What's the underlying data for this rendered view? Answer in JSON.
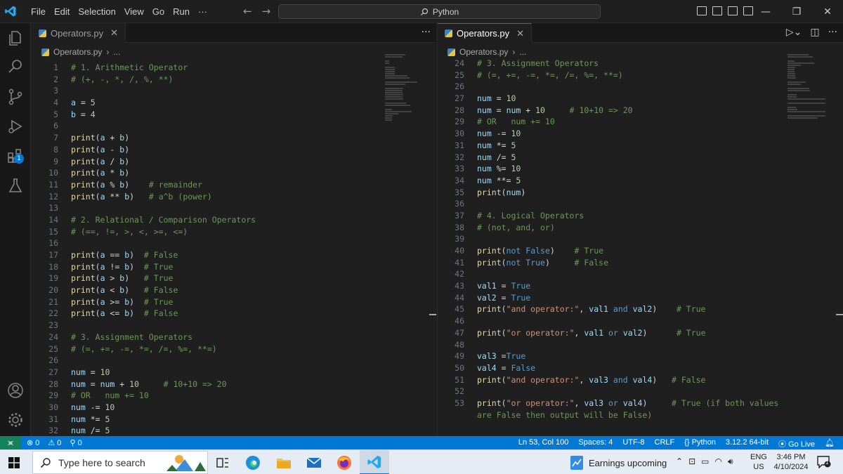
{
  "titlebar": {
    "menu": [
      "File",
      "Edit",
      "Selection",
      "View",
      "Go",
      "Run",
      "···"
    ],
    "search_text": "Python",
    "colors": {
      "accent": "#0078d4",
      "vscode_blue": "#23a9f2"
    }
  },
  "editor_left": {
    "tab_label": "Operators.py",
    "breadcrumb_file": "Operators.py",
    "breadcrumb_more": "...",
    "more_actions": "···",
    "lines": [
      {
        "n": "1",
        "segs": [
          [
            "# 1. Arithmetic Operator",
            "cm"
          ]
        ]
      },
      {
        "n": "2",
        "segs": [
          [
            "# (+, -, *, /, %, **)",
            "cm"
          ]
        ]
      },
      {
        "n": "3",
        "segs": []
      },
      {
        "n": "4",
        "segs": [
          [
            "a",
            "var"
          ],
          [
            " = ",
            "pl"
          ],
          [
            "5",
            "num"
          ]
        ]
      },
      {
        "n": "5",
        "segs": [
          [
            "b",
            "var"
          ],
          [
            " = ",
            "pl"
          ],
          [
            "4",
            "num"
          ]
        ]
      },
      {
        "n": "6",
        "segs": []
      },
      {
        "n": "7",
        "segs": [
          [
            "print",
            "fn"
          ],
          [
            "(",
            "pl"
          ],
          [
            "a",
            "var"
          ],
          [
            " + ",
            "pl"
          ],
          [
            "b",
            "var"
          ],
          [
            ")",
            "pl"
          ]
        ]
      },
      {
        "n": "8",
        "segs": [
          [
            "print",
            "fn"
          ],
          [
            "(",
            "pl"
          ],
          [
            "a",
            "var"
          ],
          [
            " - ",
            "pl"
          ],
          [
            "b",
            "var"
          ],
          [
            ")",
            "pl"
          ]
        ]
      },
      {
        "n": "9",
        "segs": [
          [
            "print",
            "fn"
          ],
          [
            "(",
            "pl"
          ],
          [
            "a",
            "var"
          ],
          [
            " / ",
            "pl"
          ],
          [
            "b",
            "var"
          ],
          [
            ")",
            "pl"
          ]
        ]
      },
      {
        "n": "10",
        "segs": [
          [
            "print",
            "fn"
          ],
          [
            "(",
            "pl"
          ],
          [
            "a",
            "var"
          ],
          [
            " * ",
            "pl"
          ],
          [
            "b",
            "var"
          ],
          [
            ")",
            "pl"
          ]
        ]
      },
      {
        "n": "11",
        "segs": [
          [
            "print",
            "fn"
          ],
          [
            "(",
            "pl"
          ],
          [
            "a",
            "var"
          ],
          [
            " % ",
            "pl"
          ],
          [
            "b",
            "var"
          ],
          [
            ")",
            "pl"
          ],
          [
            "    # remainder",
            "cm"
          ]
        ]
      },
      {
        "n": "12",
        "segs": [
          [
            "print",
            "fn"
          ],
          [
            "(",
            "pl"
          ],
          [
            "a",
            "var"
          ],
          [
            " ** ",
            "pl"
          ],
          [
            "b",
            "var"
          ],
          [
            ")",
            "pl"
          ],
          [
            "   # a^b (power)",
            "cm"
          ]
        ]
      },
      {
        "n": "13",
        "segs": []
      },
      {
        "n": "14",
        "segs": [
          [
            "# 2. Relational / Comparison Operators",
            "cm"
          ]
        ]
      },
      {
        "n": "15",
        "segs": [
          [
            "# (==, !=, >, <, >=, <=)",
            "cm"
          ]
        ]
      },
      {
        "n": "16",
        "segs": []
      },
      {
        "n": "17",
        "segs": [
          [
            "print",
            "fn"
          ],
          [
            "(",
            "pl"
          ],
          [
            "a",
            "var"
          ],
          [
            " == ",
            "pl"
          ],
          [
            "b",
            "var"
          ],
          [
            ")",
            "pl"
          ],
          [
            "  # False",
            "cm"
          ]
        ]
      },
      {
        "n": "18",
        "segs": [
          [
            "print",
            "fn"
          ],
          [
            "(",
            "pl"
          ],
          [
            "a",
            "var"
          ],
          [
            " != ",
            "pl"
          ],
          [
            "b",
            "var"
          ],
          [
            ")",
            "pl"
          ],
          [
            "  # True",
            "cm"
          ]
        ]
      },
      {
        "n": "19",
        "segs": [
          [
            "print",
            "fn"
          ],
          [
            "(",
            "pl"
          ],
          [
            "a",
            "var"
          ],
          [
            " > ",
            "pl"
          ],
          [
            "b",
            "var"
          ],
          [
            ")",
            "pl"
          ],
          [
            "   # True",
            "cm"
          ]
        ]
      },
      {
        "n": "20",
        "segs": [
          [
            "print",
            "fn"
          ],
          [
            "(",
            "pl"
          ],
          [
            "a",
            "var"
          ],
          [
            " < ",
            "pl"
          ],
          [
            "b",
            "var"
          ],
          [
            ")",
            "pl"
          ],
          [
            "   # False",
            "cm"
          ]
        ]
      },
      {
        "n": "21",
        "segs": [
          [
            "print",
            "fn"
          ],
          [
            "(",
            "pl"
          ],
          [
            "a",
            "var"
          ],
          [
            " >= ",
            "pl"
          ],
          [
            "b",
            "var"
          ],
          [
            ")",
            "pl"
          ],
          [
            "  # True",
            "cm"
          ]
        ]
      },
      {
        "n": "22",
        "segs": [
          [
            "print",
            "fn"
          ],
          [
            "(",
            "pl"
          ],
          [
            "a",
            "var"
          ],
          [
            " <= ",
            "pl"
          ],
          [
            "b",
            "var"
          ],
          [
            ")",
            "pl"
          ],
          [
            "  # False",
            "cm"
          ]
        ]
      },
      {
        "n": "23",
        "segs": []
      },
      {
        "n": "24",
        "segs": [
          [
            "# 3. Assignment Operators",
            "cm"
          ]
        ]
      },
      {
        "n": "25",
        "segs": [
          [
            "# (=, +=, -=, *=, /=, %=, **=)",
            "cm"
          ]
        ]
      },
      {
        "n": "26",
        "segs": []
      },
      {
        "n": "27",
        "segs": [
          [
            "num",
            "var"
          ],
          [
            " = ",
            "pl"
          ],
          [
            "10",
            "num"
          ]
        ]
      },
      {
        "n": "28",
        "segs": [
          [
            "num",
            "var"
          ],
          [
            " = ",
            "pl"
          ],
          [
            "num",
            "var"
          ],
          [
            " + ",
            "pl"
          ],
          [
            "10",
            "num"
          ],
          [
            "     # 10+10 => 20",
            "cm"
          ]
        ]
      },
      {
        "n": "29",
        "segs": [
          [
            "# OR   num += 10",
            "cm"
          ]
        ]
      },
      {
        "n": "30",
        "segs": [
          [
            "num",
            "var"
          ],
          [
            " -= ",
            "pl"
          ],
          [
            "10",
            "num"
          ]
        ]
      },
      {
        "n": "31",
        "segs": [
          [
            "num",
            "var"
          ],
          [
            " *= ",
            "pl"
          ],
          [
            "5",
            "num"
          ]
        ]
      },
      {
        "n": "32",
        "segs": [
          [
            "num",
            "var"
          ],
          [
            " /= ",
            "pl"
          ],
          [
            "5",
            "num"
          ]
        ]
      }
    ]
  },
  "editor_right": {
    "tab_label": "Operators.py",
    "breadcrumb_file": "Operators.py",
    "breadcrumb_more": "...",
    "lines": [
      {
        "n": "24",
        "segs": [
          [
            "# 3. Assignment Operators",
            "cm"
          ]
        ]
      },
      {
        "n": "25",
        "segs": [
          [
            "# (=, +=, -=, *=, /=, %=, **=)",
            "cm"
          ]
        ]
      },
      {
        "n": "26",
        "segs": []
      },
      {
        "n": "27",
        "segs": [
          [
            "num",
            "var"
          ],
          [
            " = ",
            "pl"
          ],
          [
            "10",
            "num"
          ]
        ]
      },
      {
        "n": "28",
        "segs": [
          [
            "num",
            "var"
          ],
          [
            " = ",
            "pl"
          ],
          [
            "num",
            "var"
          ],
          [
            " + ",
            "pl"
          ],
          [
            "10",
            "num"
          ],
          [
            "     # 10+10 => 20",
            "cm"
          ]
        ]
      },
      {
        "n": "29",
        "segs": [
          [
            "# OR   num += 10",
            "cm"
          ]
        ]
      },
      {
        "n": "30",
        "segs": [
          [
            "num",
            "var"
          ],
          [
            " -= ",
            "pl"
          ],
          [
            "10",
            "num"
          ]
        ]
      },
      {
        "n": "31",
        "segs": [
          [
            "num",
            "var"
          ],
          [
            " *= ",
            "pl"
          ],
          [
            "5",
            "num"
          ]
        ]
      },
      {
        "n": "32",
        "segs": [
          [
            "num",
            "var"
          ],
          [
            " /= ",
            "pl"
          ],
          [
            "5",
            "num"
          ]
        ]
      },
      {
        "n": "33",
        "segs": [
          [
            "num",
            "var"
          ],
          [
            " %= ",
            "pl"
          ],
          [
            "10",
            "num"
          ]
        ]
      },
      {
        "n": "34",
        "segs": [
          [
            "num",
            "var"
          ],
          [
            " **= ",
            "pl"
          ],
          [
            "5",
            "num"
          ]
        ]
      },
      {
        "n": "35",
        "segs": [
          [
            "print",
            "fn"
          ],
          [
            "(",
            "pl"
          ],
          [
            "num",
            "var"
          ],
          [
            ")",
            "pl"
          ]
        ]
      },
      {
        "n": "36",
        "segs": []
      },
      {
        "n": "37",
        "segs": [
          [
            "# 4. Logical Operators",
            "cm"
          ]
        ]
      },
      {
        "n": "38",
        "segs": [
          [
            "# (not, and, or)",
            "cm"
          ]
        ]
      },
      {
        "n": "39",
        "segs": []
      },
      {
        "n": "40",
        "segs": [
          [
            "print",
            "fn"
          ],
          [
            "(",
            "pl"
          ],
          [
            "not",
            "kw"
          ],
          [
            " ",
            "pl"
          ],
          [
            "False",
            "kw"
          ],
          [
            ")",
            "pl"
          ],
          [
            "    # True",
            "cm"
          ]
        ]
      },
      {
        "n": "41",
        "segs": [
          [
            "print",
            "fn"
          ],
          [
            "(",
            "pl"
          ],
          [
            "not",
            "kw"
          ],
          [
            " ",
            "pl"
          ],
          [
            "True",
            "kw"
          ],
          [
            ")",
            "pl"
          ],
          [
            "     # False",
            "cm"
          ]
        ]
      },
      {
        "n": "42",
        "segs": []
      },
      {
        "n": "43",
        "segs": [
          [
            "val1",
            "var"
          ],
          [
            " = ",
            "pl"
          ],
          [
            "True",
            "kw"
          ]
        ]
      },
      {
        "n": "44",
        "segs": [
          [
            "val2",
            "var"
          ],
          [
            " = ",
            "pl"
          ],
          [
            "True",
            "kw"
          ]
        ]
      },
      {
        "n": "45",
        "segs": [
          [
            "print",
            "fn"
          ],
          [
            "(",
            "pl"
          ],
          [
            "\"and operator:\"",
            "str"
          ],
          [
            ", ",
            "pl"
          ],
          [
            "val1",
            "var"
          ],
          [
            " and ",
            "kw"
          ],
          [
            "val2",
            "var"
          ],
          [
            ")",
            "pl"
          ],
          [
            "    # True",
            "cm"
          ]
        ]
      },
      {
        "n": "46",
        "segs": []
      },
      {
        "n": "47",
        "segs": [
          [
            "print",
            "fn"
          ],
          [
            "(",
            "pl"
          ],
          [
            "\"or operator:\"",
            "str"
          ],
          [
            ", ",
            "pl"
          ],
          [
            "val1",
            "var"
          ],
          [
            " or ",
            "kw"
          ],
          [
            "val2",
            "var"
          ],
          [
            ")",
            "pl"
          ],
          [
            "      # True",
            "cm"
          ]
        ]
      },
      {
        "n": "48",
        "segs": []
      },
      {
        "n": "49",
        "segs": [
          [
            "val3",
            "var"
          ],
          [
            " =",
            "pl"
          ],
          [
            "True",
            "kw"
          ]
        ]
      },
      {
        "n": "50",
        "segs": [
          [
            "val4",
            "var"
          ],
          [
            " = ",
            "pl"
          ],
          [
            "False",
            "kw"
          ]
        ]
      },
      {
        "n": "51",
        "segs": [
          [
            "print",
            "fn"
          ],
          [
            "(",
            "pl"
          ],
          [
            "\"and operator:\"",
            "str"
          ],
          [
            ", ",
            "pl"
          ],
          [
            "val3",
            "var"
          ],
          [
            " and ",
            "kw"
          ],
          [
            "val4",
            "var"
          ],
          [
            ")",
            "pl"
          ],
          [
            "   # False",
            "cm"
          ]
        ]
      },
      {
        "n": "52",
        "segs": []
      },
      {
        "n": "53",
        "segs": [
          [
            "print",
            "fn"
          ],
          [
            "(",
            "pl"
          ],
          [
            "\"or operator:\"",
            "str"
          ],
          [
            ", ",
            "pl"
          ],
          [
            "val3",
            "var"
          ],
          [
            " or ",
            "kw"
          ],
          [
            "val4",
            "var"
          ],
          [
            ")",
            "pl"
          ],
          [
            "     # True (if both values",
            "cm"
          ]
        ]
      },
      {
        "n": "",
        "segs": [
          [
            "are False then output will be False)",
            "cm"
          ]
        ]
      }
    ]
  },
  "statusbar": {
    "errors": "⊗ 0",
    "warnings": "⚠ 0",
    "ports": "0",
    "position": "Ln 53, Col 100",
    "spaces": "Spaces: 4",
    "encoding": "UTF-8",
    "eol": "CRLF",
    "language": "{} Python",
    "interpreter": "3.12.2 64-bit",
    "golive": "Go Live"
  },
  "taskbar": {
    "search_placeholder": "Type here to search",
    "news": "Earnings upcoming",
    "lang_1": "ENG",
    "lang_2": "US",
    "time": "3:46 PM",
    "date": "4/10/2024",
    "notif_count": "1"
  },
  "activity": {
    "extensions_badge": "1"
  }
}
